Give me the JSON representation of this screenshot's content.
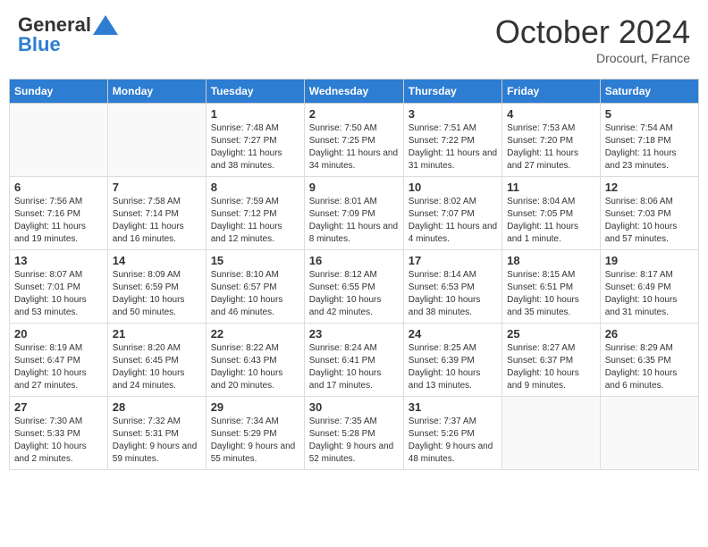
{
  "header": {
    "logo_general": "General",
    "logo_blue": "Blue",
    "month": "October 2024",
    "location": "Drocourt, France"
  },
  "weekdays": [
    "Sunday",
    "Monday",
    "Tuesday",
    "Wednesday",
    "Thursday",
    "Friday",
    "Saturday"
  ],
  "weeks": [
    [
      {
        "day": "",
        "info": ""
      },
      {
        "day": "",
        "info": ""
      },
      {
        "day": "1",
        "info": "Sunrise: 7:48 AM\nSunset: 7:27 PM\nDaylight: 11 hours and 38 minutes."
      },
      {
        "day": "2",
        "info": "Sunrise: 7:50 AM\nSunset: 7:25 PM\nDaylight: 11 hours and 34 minutes."
      },
      {
        "day": "3",
        "info": "Sunrise: 7:51 AM\nSunset: 7:22 PM\nDaylight: 11 hours and 31 minutes."
      },
      {
        "day": "4",
        "info": "Sunrise: 7:53 AM\nSunset: 7:20 PM\nDaylight: 11 hours and 27 minutes."
      },
      {
        "day": "5",
        "info": "Sunrise: 7:54 AM\nSunset: 7:18 PM\nDaylight: 11 hours and 23 minutes."
      }
    ],
    [
      {
        "day": "6",
        "info": "Sunrise: 7:56 AM\nSunset: 7:16 PM\nDaylight: 11 hours and 19 minutes."
      },
      {
        "day": "7",
        "info": "Sunrise: 7:58 AM\nSunset: 7:14 PM\nDaylight: 11 hours and 16 minutes."
      },
      {
        "day": "8",
        "info": "Sunrise: 7:59 AM\nSunset: 7:12 PM\nDaylight: 11 hours and 12 minutes."
      },
      {
        "day": "9",
        "info": "Sunrise: 8:01 AM\nSunset: 7:09 PM\nDaylight: 11 hours and 8 minutes."
      },
      {
        "day": "10",
        "info": "Sunrise: 8:02 AM\nSunset: 7:07 PM\nDaylight: 11 hours and 4 minutes."
      },
      {
        "day": "11",
        "info": "Sunrise: 8:04 AM\nSunset: 7:05 PM\nDaylight: 11 hours and 1 minute."
      },
      {
        "day": "12",
        "info": "Sunrise: 8:06 AM\nSunset: 7:03 PM\nDaylight: 10 hours and 57 minutes."
      }
    ],
    [
      {
        "day": "13",
        "info": "Sunrise: 8:07 AM\nSunset: 7:01 PM\nDaylight: 10 hours and 53 minutes."
      },
      {
        "day": "14",
        "info": "Sunrise: 8:09 AM\nSunset: 6:59 PM\nDaylight: 10 hours and 50 minutes."
      },
      {
        "day": "15",
        "info": "Sunrise: 8:10 AM\nSunset: 6:57 PM\nDaylight: 10 hours and 46 minutes."
      },
      {
        "day": "16",
        "info": "Sunrise: 8:12 AM\nSunset: 6:55 PM\nDaylight: 10 hours and 42 minutes."
      },
      {
        "day": "17",
        "info": "Sunrise: 8:14 AM\nSunset: 6:53 PM\nDaylight: 10 hours and 38 minutes."
      },
      {
        "day": "18",
        "info": "Sunrise: 8:15 AM\nSunset: 6:51 PM\nDaylight: 10 hours and 35 minutes."
      },
      {
        "day": "19",
        "info": "Sunrise: 8:17 AM\nSunset: 6:49 PM\nDaylight: 10 hours and 31 minutes."
      }
    ],
    [
      {
        "day": "20",
        "info": "Sunrise: 8:19 AM\nSunset: 6:47 PM\nDaylight: 10 hours and 27 minutes."
      },
      {
        "day": "21",
        "info": "Sunrise: 8:20 AM\nSunset: 6:45 PM\nDaylight: 10 hours and 24 minutes."
      },
      {
        "day": "22",
        "info": "Sunrise: 8:22 AM\nSunset: 6:43 PM\nDaylight: 10 hours and 20 minutes."
      },
      {
        "day": "23",
        "info": "Sunrise: 8:24 AM\nSunset: 6:41 PM\nDaylight: 10 hours and 17 minutes."
      },
      {
        "day": "24",
        "info": "Sunrise: 8:25 AM\nSunset: 6:39 PM\nDaylight: 10 hours and 13 minutes."
      },
      {
        "day": "25",
        "info": "Sunrise: 8:27 AM\nSunset: 6:37 PM\nDaylight: 10 hours and 9 minutes."
      },
      {
        "day": "26",
        "info": "Sunrise: 8:29 AM\nSunset: 6:35 PM\nDaylight: 10 hours and 6 minutes."
      }
    ],
    [
      {
        "day": "27",
        "info": "Sunrise: 7:30 AM\nSunset: 5:33 PM\nDaylight: 10 hours and 2 minutes."
      },
      {
        "day": "28",
        "info": "Sunrise: 7:32 AM\nSunset: 5:31 PM\nDaylight: 9 hours and 59 minutes."
      },
      {
        "day": "29",
        "info": "Sunrise: 7:34 AM\nSunset: 5:29 PM\nDaylight: 9 hours and 55 minutes."
      },
      {
        "day": "30",
        "info": "Sunrise: 7:35 AM\nSunset: 5:28 PM\nDaylight: 9 hours and 52 minutes."
      },
      {
        "day": "31",
        "info": "Sunrise: 7:37 AM\nSunset: 5:26 PM\nDaylight: 9 hours and 48 minutes."
      },
      {
        "day": "",
        "info": ""
      },
      {
        "day": "",
        "info": ""
      }
    ]
  ]
}
